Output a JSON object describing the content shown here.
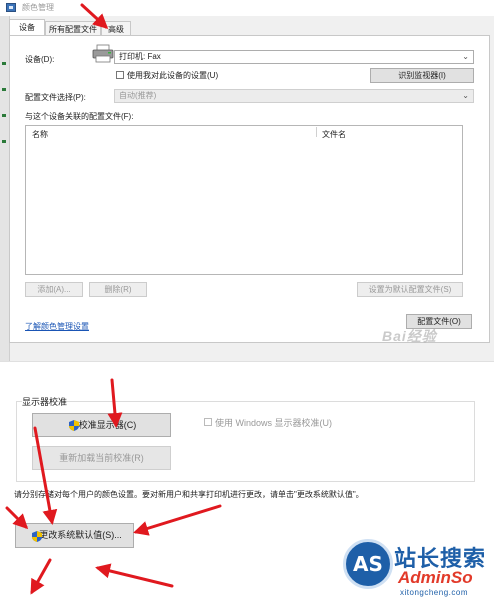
{
  "window": {
    "title": "颜色管理"
  },
  "tabs": [
    {
      "label": "设备"
    },
    {
      "label": "所有配置文件"
    },
    {
      "label": "高级"
    }
  ],
  "device": {
    "label": "设备(D):",
    "selected": "打印机: Fax",
    "use_my_settings": "使用我对此设备的设置(U)",
    "identify_button": "识别监视器(I)"
  },
  "profile_select": {
    "label": "配置文件选择(P):",
    "value": "自动(推荐)"
  },
  "profiles": {
    "label": "与这个设备关联的配置文件(F):",
    "columns": [
      "名称",
      "文件名"
    ],
    "rows": []
  },
  "buttons": {
    "add": "添加(A)...",
    "remove": "删除(R)",
    "set_default": "设置为默认配置文件(S)",
    "profiles": "配置文件(O)"
  },
  "link": {
    "learn_more": "了解颜色管理设置"
  },
  "watermark": {
    "baidu": "Bai经验"
  },
  "calibration": {
    "section_title": "显示器校准",
    "calibrate_button": "校准显示器(C)",
    "use_windows_calibration": "使用 Windows 显示器校准(U)",
    "reload_button": "重新加载当前校准(R)"
  },
  "system_defaults": {
    "hint": "请分别存储对每个用户的颜色设置。要对新用户和共享打印机进行更改，请单击\"更改系统默认值\"。",
    "change_button": "更改系统默认值(S)..."
  },
  "logo": {
    "badge": "AS",
    "cn": "站长搜索",
    "en": "AdminSo",
    "url": "xitongcheng.com"
  },
  "colors": {
    "arrow": "#e0191f",
    "logo_blue": "#1e5fa8",
    "logo_red": "#e23a2a"
  }
}
